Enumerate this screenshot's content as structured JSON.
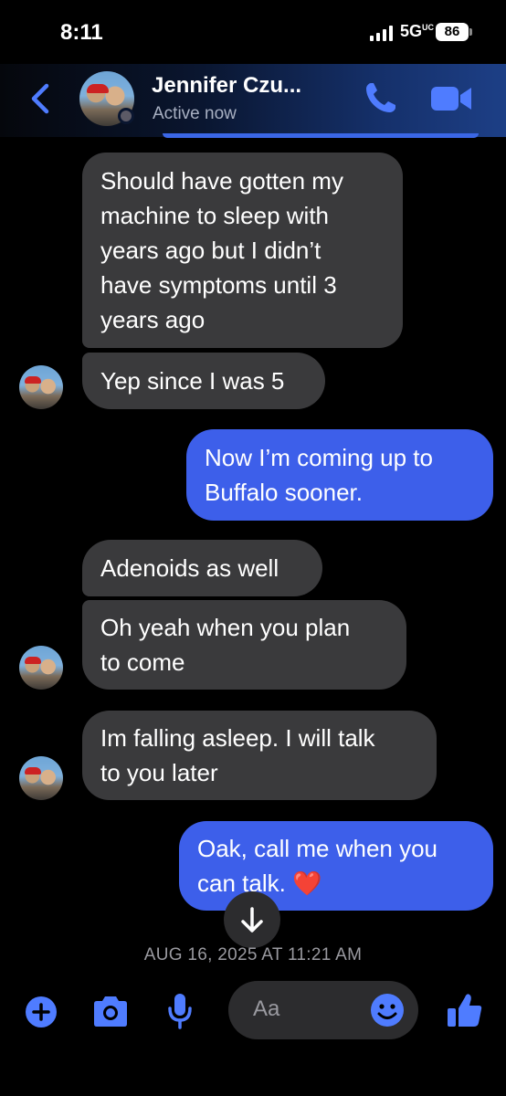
{
  "status_bar": {
    "time": "8:11",
    "network": "5G",
    "network_sup": "UC",
    "battery": "86"
  },
  "header": {
    "contact_name": "Jennifer Czu...",
    "status": "Active now"
  },
  "messages": [
    {
      "dir": "in",
      "lines": [
        "Should have gotten my",
        "machine to sleep with",
        "years ago but I didn’t",
        "have symptoms until 3",
        "years ago"
      ]
    },
    {
      "dir": "in",
      "lines": [
        "Yep since I was 5"
      ],
      "avatar": true
    },
    {
      "dir": "out",
      "lines": [
        "Now I’m coming up to",
        "Buffalo sooner."
      ]
    },
    {
      "dir": "in",
      "lines": [
        "Adenoids as well"
      ]
    },
    {
      "dir": "in",
      "lines": [
        "Oh yeah when you plan",
        "to come"
      ],
      "avatar": true
    },
    {
      "dir": "in",
      "lines": [
        "Im falling asleep. I will talk",
        "to you later"
      ],
      "avatar": true
    },
    {
      "dir": "out",
      "lines": [
        "Oak, call me when you",
        "can talk. ❤️"
      ]
    }
  ],
  "date_separator": "AUG 16, 2025 AT 11:21 AM",
  "composer": {
    "placeholder": "Aa"
  },
  "colors": {
    "incoming": "#3a3a3c",
    "outgoing": "#3d5fea",
    "accent": "#4f7cff"
  },
  "icons": [
    "back-chevron-icon",
    "phone-icon",
    "video-camera-icon",
    "plus-icon",
    "camera-icon",
    "microphone-icon",
    "smiley-icon",
    "thumbs-up-icon",
    "arrow-down-icon"
  ]
}
